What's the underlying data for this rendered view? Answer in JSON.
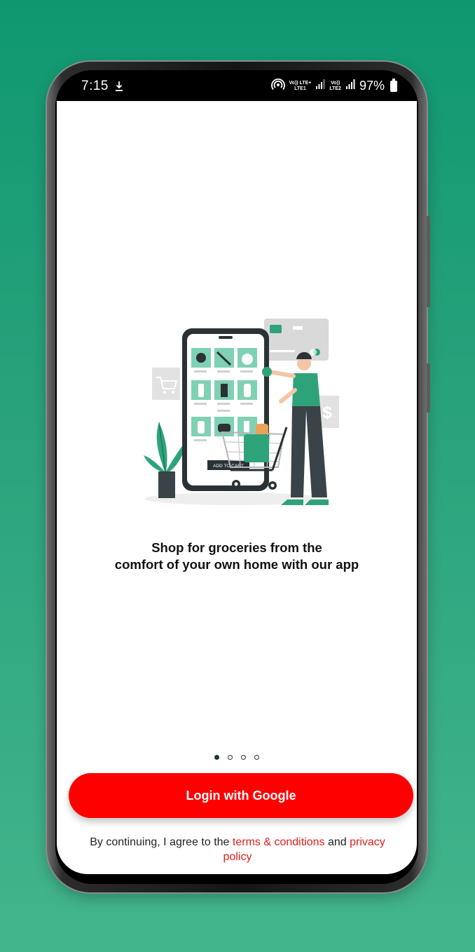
{
  "status_bar": {
    "time": "7:15",
    "network1_top": "Vo)) LTE+",
    "network1_bottom": "LTE1",
    "network2_top": "Vo))",
    "network2_bottom": "LTE2",
    "battery": "97%"
  },
  "illustration": {
    "button_text": "ADD TO CART"
  },
  "onboarding": {
    "headline_line1": "Shop for groceries from the",
    "headline_line2": "comfort of your own home with our app",
    "page_count": 4,
    "active_page": 1
  },
  "login_button": {
    "label": "Login with Google"
  },
  "terms": {
    "prefix": "By continuing, I agree to the ",
    "terms_link": "terms & conditions",
    "middle": " and ",
    "privacy_link": "privacy policy"
  },
  "colors": {
    "background_top": "#0f9870",
    "background_bottom": "#43b58d",
    "primary_button": "#ff0000",
    "link": "#e0201e",
    "illustration_green": "#2ea37a"
  }
}
